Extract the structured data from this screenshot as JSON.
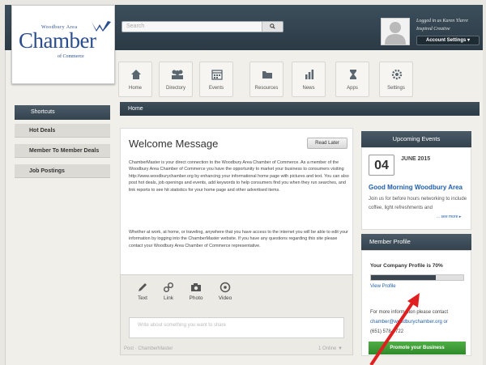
{
  "logo": {
    "top_text": "Woodbury Area",
    "main_text": "Chamber",
    "sub_text": "of Commerce"
  },
  "search": {
    "placeholder": "Search",
    "button_icon": "search-icon"
  },
  "user": {
    "logged_in_as": "Logged in as Karen Ylarre",
    "status": "Inspired Creative",
    "account_button": "Account Settings ▾"
  },
  "nav": [
    {
      "label": "Home",
      "icon": "home-icon"
    },
    {
      "label": "Directory",
      "icon": "people-icon"
    },
    {
      "label": "Events",
      "icon": "calendar-icon"
    },
    {
      "label": "Resources",
      "icon": "folder-icon"
    },
    {
      "label": "News",
      "icon": "news-icon"
    },
    {
      "label": "Apps",
      "icon": "hourglass-icon"
    },
    {
      "label": "Settings",
      "icon": "gear-icon"
    }
  ],
  "sidebar": {
    "title": "Shortcuts",
    "items": [
      {
        "label": "Hot Deals"
      },
      {
        "label": "Member To Member Deals"
      },
      {
        "label": "Job Postings"
      }
    ]
  },
  "breadcrumb": "Home",
  "welcome": {
    "title": "Welcome Message",
    "read_later": "Read Later",
    "p1": "ChamberMaster is your direct connection to the Woodbury Area Chamber of Commerce. As a member of the Woodbury Area Chamber of Commerce you have the opportunity to market your business to consumers visiting http://www.woodburychamber.org by enhancing your informational home page with pictures and text. You can also post hot deals, job openings and events, add keywords to help consumers find you when they run searches, and link reports to see hit statistics for your home page and other advertised items.",
    "p2": "Whether at work, at home, or traveling, anywhere that you have access to the internet you will be able to edit your information by logging into the ChamberMaster website. If you have any questions regarding this site please contact your Woodbury Area Chamber of Commerce representative."
  },
  "composer": {
    "tools": [
      {
        "label": "Text",
        "icon": "pencil-icon"
      },
      {
        "label": "Link",
        "icon": "link-icon"
      },
      {
        "label": "Photo",
        "icon": "camera-icon"
      },
      {
        "label": "Video",
        "icon": "play-icon"
      }
    ],
    "placeholder": "Write about something you want to share",
    "footer_left": "Post · ChamberMaster",
    "footer_right": "1 Online ▼"
  },
  "events": {
    "title": "Upcoming Events",
    "day": "04",
    "month": "JUNE 2015",
    "event_title": "Good Morning Woodbury Area",
    "event_desc": "Join us for before hours networking to include coffee, light refreshments and",
    "see_more": "... see more ▸"
  },
  "profile": {
    "title": "Member Profile",
    "completion_text": "Your Company Profile is 70%",
    "completion": 0.7,
    "view_link": "View Profile",
    "contact_1": "For more information please contact",
    "contact_2": "chamber@woodburychamber.org or",
    "contact_3": "(651) 578-0722",
    "promote_button": "Promote your Business"
  },
  "colors": {
    "header": "#2e3d48",
    "link": "#1f5fa8",
    "promote": "#3a9a33",
    "annotation_arrow": "#e02020"
  }
}
